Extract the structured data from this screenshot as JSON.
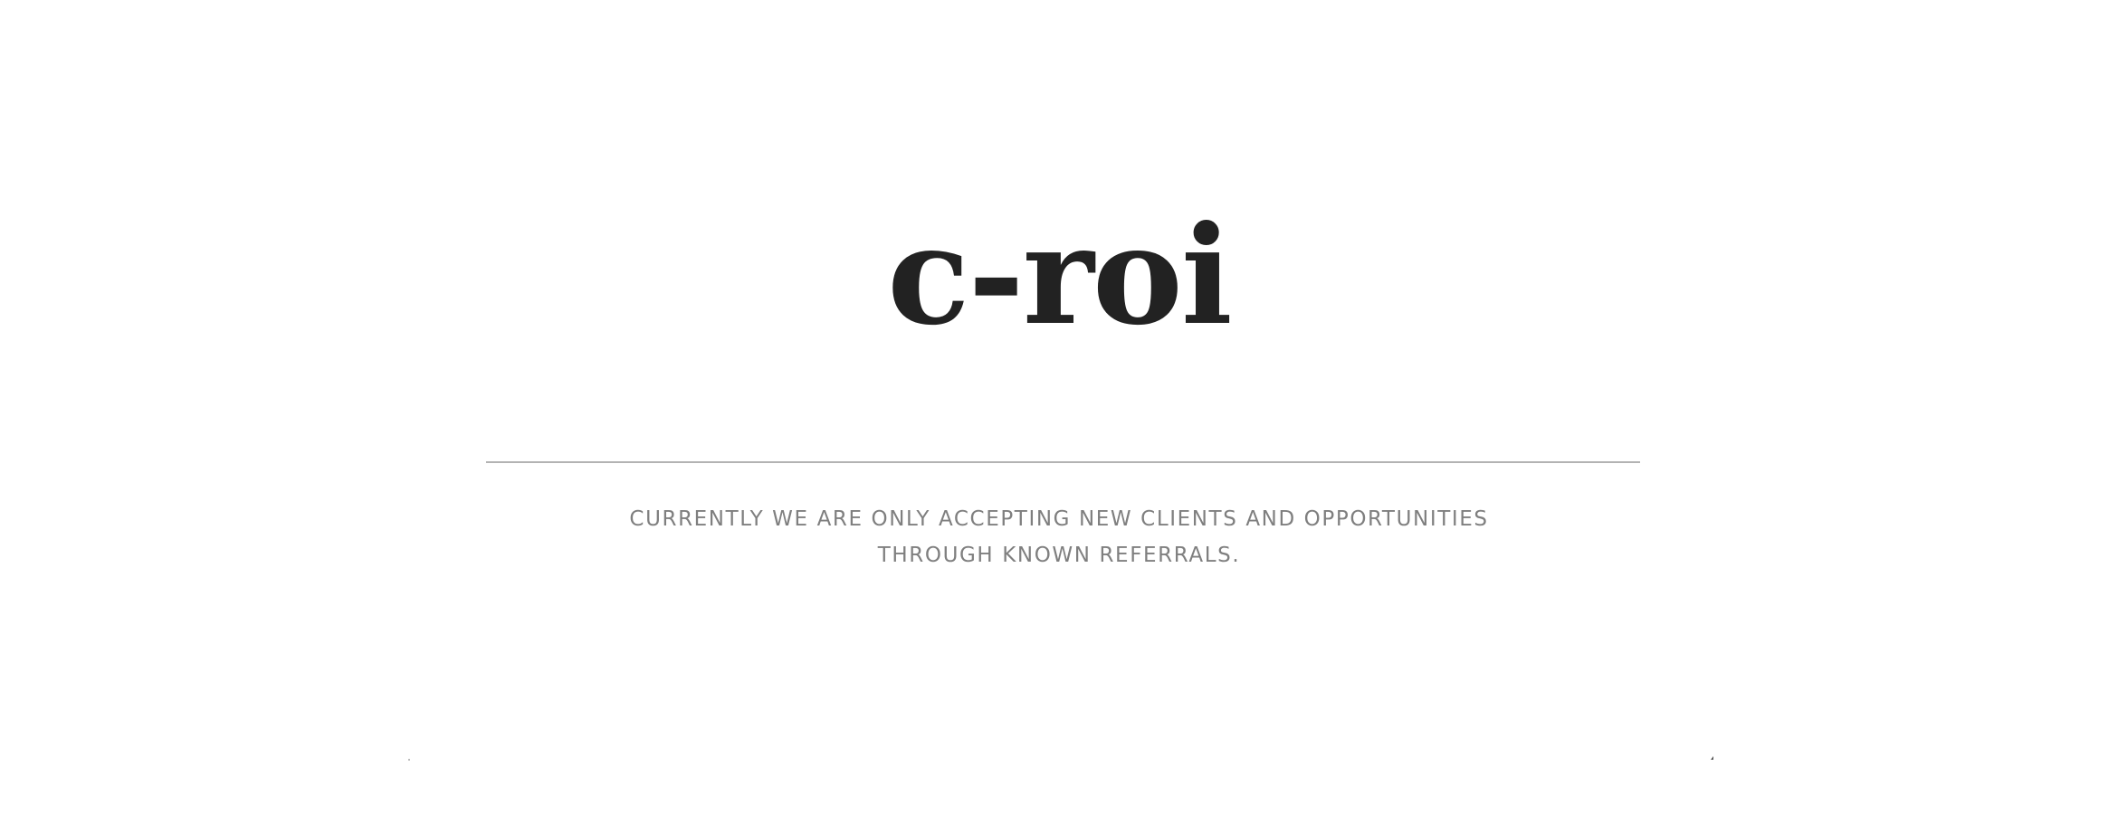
{
  "brand": {
    "logo_text": "c-roi"
  },
  "notice": {
    "line1": "CURRENTLY WE ARE ONLY ACCEPTING NEW CLIENTS AND OPPORTUNITIES",
    "line2": "THROUGH KNOWN REFERRALS."
  },
  "colors": {
    "background": "#ffffff",
    "logo": "#222222",
    "text": "#7f7f7f",
    "divider": "#b3b3b3"
  }
}
